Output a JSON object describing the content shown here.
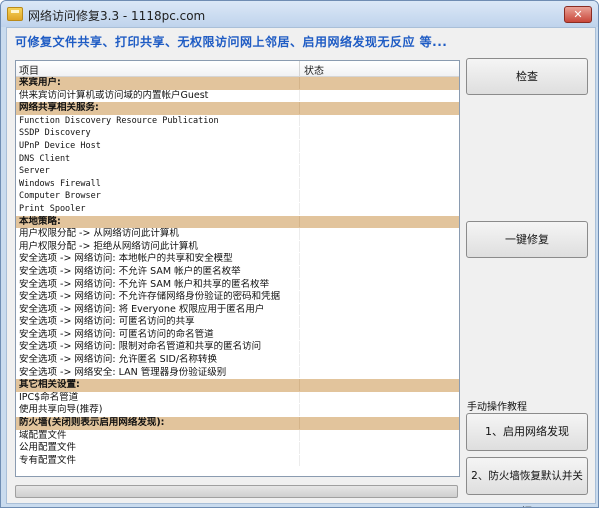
{
  "window": {
    "title": "网络访问修复3.3 - 1118pc.com",
    "close_label": "✕"
  },
  "banner": "可修复文件共享、打印共享、无权限访问网上邻居、启用网络发现无反应  等...",
  "list": {
    "columns": [
      "项目",
      "状态"
    ],
    "rows": [
      {
        "text": "来宾用户:",
        "section": true
      },
      {
        "text": "供来宾访问计算机或访问域的内置帐户Guest",
        "section": false
      },
      {
        "text": "网络共享相关服务:",
        "section": true
      },
      {
        "text": "Function Discovery Resource Publication",
        "section": false,
        "mono": true
      },
      {
        "text": "SSDP Discovery",
        "section": false,
        "mono": true
      },
      {
        "text": "UPnP Device Host",
        "section": false,
        "mono": true
      },
      {
        "text": "DNS Client",
        "section": false,
        "mono": true
      },
      {
        "text": "Server",
        "section": false,
        "mono": true
      },
      {
        "text": "Windows Firewall",
        "section": false,
        "mono": true
      },
      {
        "text": "Computer Browser",
        "section": false,
        "mono": true
      },
      {
        "text": "Print Spooler",
        "section": false,
        "mono": true
      },
      {
        "text": "本地策略:",
        "section": true
      },
      {
        "text": "用户权限分配 -> 从网络访问此计算机",
        "section": false
      },
      {
        "text": "用户权限分配 -> 拒绝从网络访问此计算机",
        "section": false
      },
      {
        "text": "安全选项 -> 网络访问: 本地帐户的共享和安全模型",
        "section": false
      },
      {
        "text": "安全选项 -> 网络访问: 不允许 SAM 帐户的匿名枚举",
        "section": false
      },
      {
        "text": "安全选项 -> 网络访问: 不允许 SAM 帐户和共享的匿名枚举",
        "section": false
      },
      {
        "text": "安全选项 -> 网络访问: 不允许存储网络身份验证的密码和凭据",
        "section": false
      },
      {
        "text": "安全选项 -> 网络访问: 将 Everyone 权限应用于匿名用户",
        "section": false
      },
      {
        "text": "安全选项 -> 网络访问: 可匿名访问的共享",
        "section": false
      },
      {
        "text": "安全选项 -> 网络访问: 可匿名访问的命名管道",
        "section": false
      },
      {
        "text": "安全选项 -> 网络访问: 限制对命名管道和共享的匿名访问",
        "section": false
      },
      {
        "text": "安全选项 -> 网络访问: 允许匿名 SID/名称转换",
        "section": false
      },
      {
        "text": "安全选项 -> 网络安全: LAN 管理器身份验证级别",
        "section": false
      },
      {
        "text": "其它相关设置:",
        "section": true
      },
      {
        "text": "IPC$命名管道",
        "section": false
      },
      {
        "text": "使用共享向导(推荐)",
        "section": false
      },
      {
        "text": "防火墙(关闭则表示启用网络发现):",
        "section": true
      },
      {
        "text": "域配置文件",
        "section": false
      },
      {
        "text": "公用配置文件",
        "section": false
      },
      {
        "text": "专有配置文件",
        "section": false
      }
    ]
  },
  "buttons": {
    "check": "检查",
    "fix": "一键修复",
    "manual_label": "手动操作教程",
    "enable_discovery": "1、启用网络发现",
    "firewall_restore": "2、防火墙恢复默认并关闭"
  },
  "progress": {
    "value": 0
  },
  "colors": {
    "banner": "#1f5cc4",
    "section_bg": "#e2c49c",
    "titlebar": "#c9dbee"
  }
}
